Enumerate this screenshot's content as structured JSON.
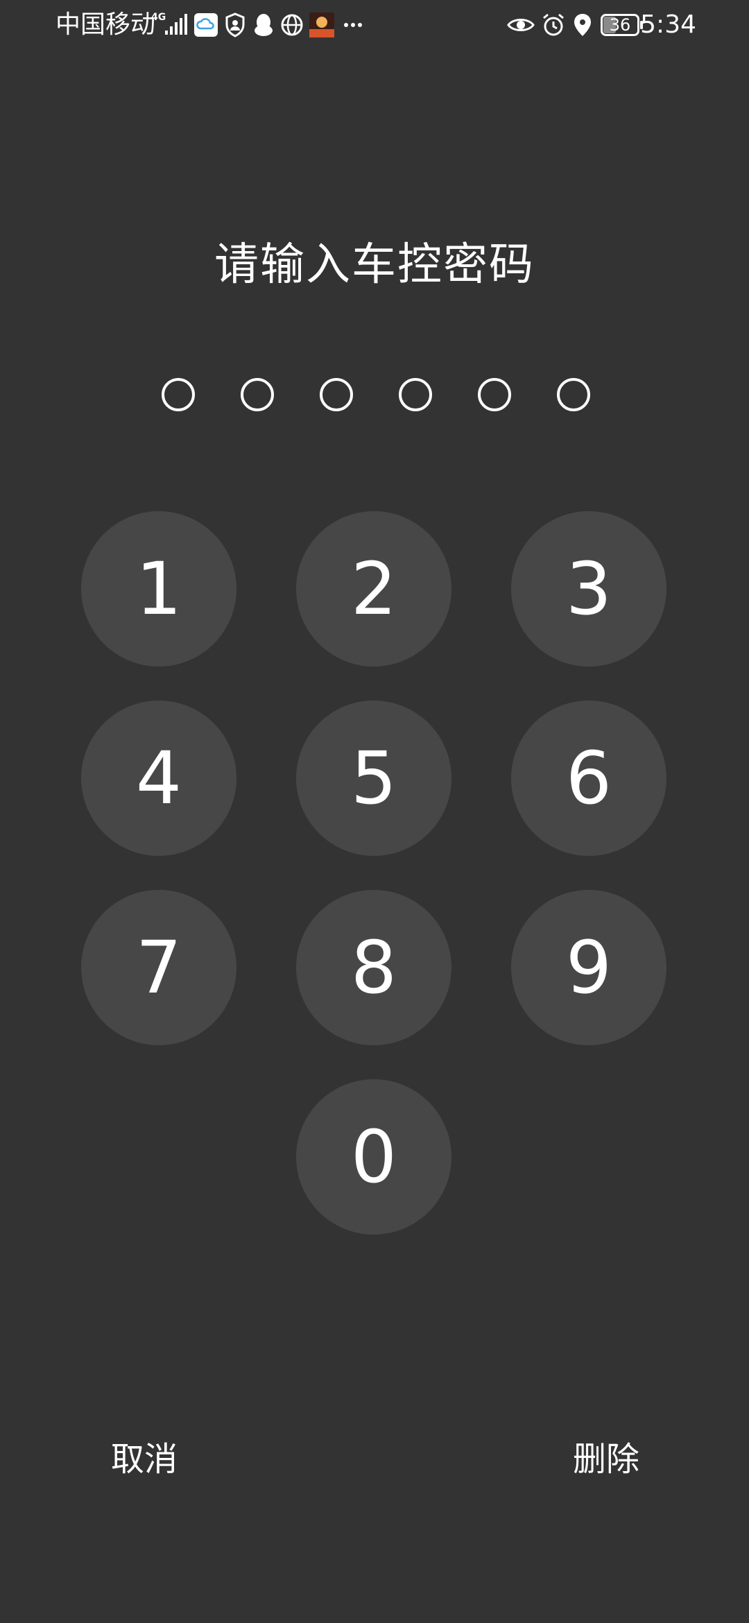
{
  "status_bar": {
    "carrier": "中国移动",
    "network_type": "4G",
    "time": "5:34",
    "battery_level": "36",
    "icons": [
      "cloud-icon",
      "shield-user-icon",
      "qq-penguin-icon",
      "globe-icon",
      "app-thumbnail-icon",
      "more-dots-icon",
      "eye-icon",
      "alarm-icon",
      "location-icon"
    ]
  },
  "title": "请输入车控密码",
  "pin": {
    "length": 6,
    "entered": 0
  },
  "keypad": {
    "keys": [
      "1",
      "2",
      "3",
      "4",
      "5",
      "6",
      "7",
      "8",
      "9",
      "0"
    ]
  },
  "actions": {
    "cancel_label": "取消",
    "delete_label": "删除"
  },
  "colors": {
    "background": "#333333",
    "key_background": "#474747",
    "text": "#ffffff"
  }
}
